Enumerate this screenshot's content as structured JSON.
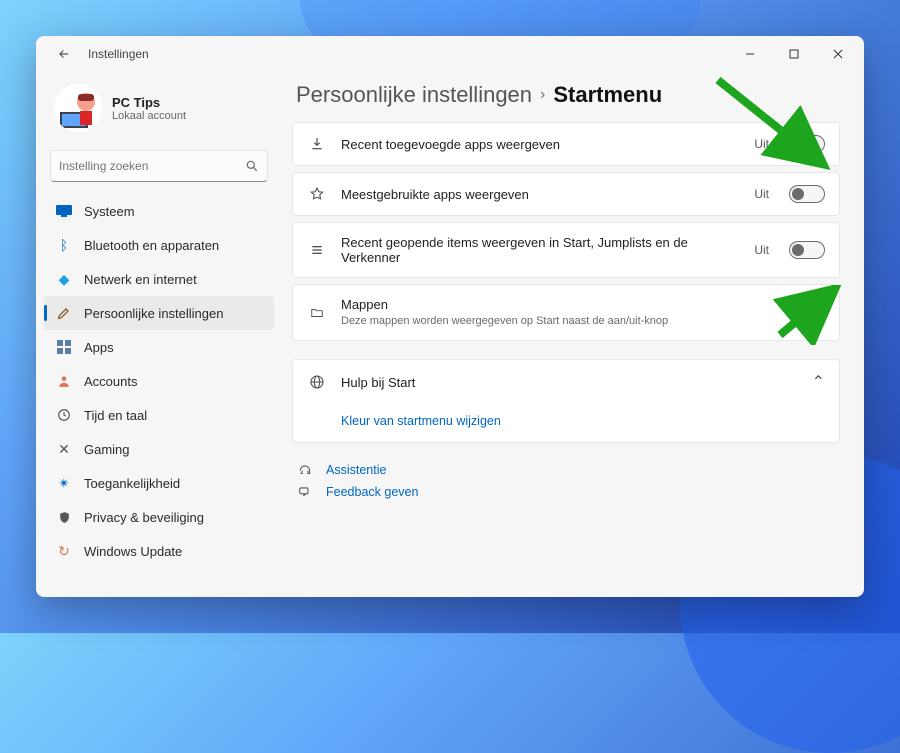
{
  "window": {
    "title": "Instellingen"
  },
  "profile": {
    "name": "PC Tips",
    "sub": "Lokaal account"
  },
  "search": {
    "placeholder": "Instelling zoeken"
  },
  "nav": {
    "systeem": "Systeem",
    "bluetooth": "Bluetooth en apparaten",
    "netwerk": "Netwerk en internet",
    "persoon": "Persoonlijke instellingen",
    "apps": "Apps",
    "accounts": "Accounts",
    "tijd": "Tijd en taal",
    "gaming": "Gaming",
    "toegang": "Toegankelijkheid",
    "privacy": "Privacy & beveiliging",
    "update": "Windows Update"
  },
  "breadcrumb": {
    "parent": "Persoonlijke instellingen",
    "current": "Startmenu"
  },
  "rows": {
    "recent_added": {
      "label": "Recent toegevoegde apps weergeven",
      "state": "Uit"
    },
    "most_used": {
      "label": "Meestgebruikte apps weergeven",
      "state": "Uit"
    },
    "recent_items": {
      "label": "Recent geopende items weergeven in Start, Jumplists en de Verkenner",
      "state": "Uit"
    },
    "folders": {
      "title": "Mappen",
      "sub": "Deze mappen worden weergegeven op Start naast de aan/uit-knop"
    }
  },
  "help": {
    "title": "Hulp bij Start",
    "link": "Kleur van startmenu wijzigen"
  },
  "footer": {
    "assist": "Assistentie",
    "feedback": "Feedback geven"
  }
}
